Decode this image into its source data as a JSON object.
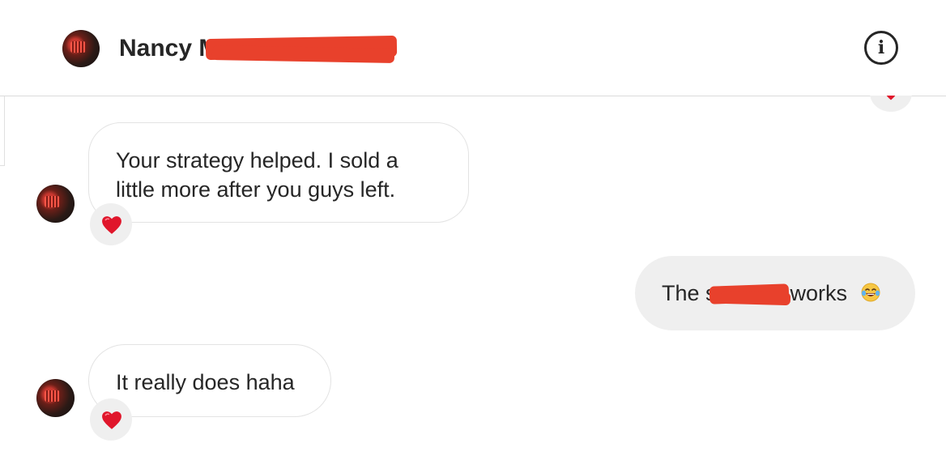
{
  "header": {
    "contact_name": "Nancy M",
    "info_icon_glyph": "i"
  },
  "messages": [
    {
      "direction": "incoming",
      "line1": "Your strategy helped. I sold a",
      "line2": "little more after you guys left.",
      "reaction": "heart"
    },
    {
      "direction": "outgoing",
      "text_before": "The s",
      "text_after": "y works",
      "emoji": "face-with-tears-of-joy"
    },
    {
      "direction": "incoming",
      "text": "It really does haha",
      "reaction": "heart"
    }
  ],
  "colors": {
    "redaction": "#e8412c",
    "heart": "#e0162b",
    "outgoing_bubble": "#efefef",
    "incoming_border": "#e3e3e3",
    "text": "#262626"
  },
  "icons": [
    "info-icon",
    "heart-reaction-icon",
    "laughing-emoji-icon"
  ]
}
